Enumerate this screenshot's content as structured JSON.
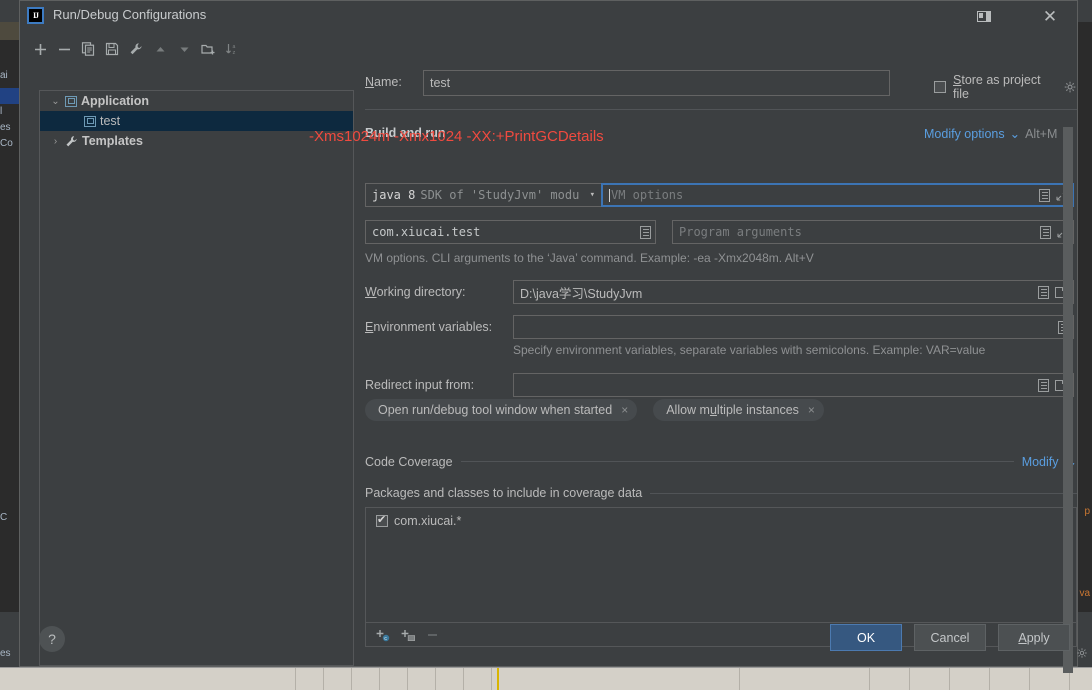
{
  "window": {
    "title": "Run/Debug Configurations",
    "logo_text": "IJ",
    "panel_toggle_icon": "split-panel-icon",
    "close_icon": "close-icon"
  },
  "toolbar": {
    "items": [
      {
        "name": "add-configuration-button",
        "glyph": "+"
      },
      {
        "name": "remove-configuration-button",
        "glyph": "−"
      },
      {
        "name": "copy-configuration-button",
        "glyph": "copy-icon"
      },
      {
        "name": "save-configuration-button",
        "glyph": "save-icon"
      },
      {
        "name": "edit-templates-button",
        "glyph": "wrench-icon"
      },
      {
        "name": "move-up-button",
        "glyph": "▲"
      },
      {
        "name": "move-down-button",
        "glyph": "▼"
      },
      {
        "name": "new-folder-button",
        "glyph": "folder-plus-icon"
      },
      {
        "name": "sort-alphabetically-button",
        "glyph": "sort-az-icon"
      }
    ]
  },
  "tree": {
    "nodes": [
      {
        "label": "Application",
        "expanded": true,
        "selected": false,
        "chevron": "⌄",
        "icon": "application-icon"
      },
      {
        "label": "test",
        "expanded": false,
        "selected": true,
        "chevron": "",
        "icon": "application-icon"
      },
      {
        "label": "Templates",
        "expanded": false,
        "selected": false,
        "chevron": "›",
        "icon": "wrench-icon"
      }
    ]
  },
  "settings": {
    "name_label": "Name:",
    "name_value": "test",
    "store_as_project_file": {
      "label": "Store as project file",
      "checked": false,
      "gear_icon": "gear-icon"
    },
    "build_and_run": {
      "section_title": "Build and run",
      "modify_options_link": "Modify options",
      "modify_options_caret": "⌄",
      "modify_options_accel": "Alt+M",
      "jdk_value_bold": "java 8",
      "jdk_value_rest": "SDK of 'StudyJvm' modu",
      "jdk_caret": "▾",
      "vm_options_placeholder": "VM options",
      "vm_options_value": "",
      "main_class_value": "com.xiucai.test",
      "program_arguments_placeholder": "Program arguments",
      "hint": "VM options. CLI arguments to the ‘Java’ command. Example: -ea -Xmx2048m. Alt+V"
    },
    "working_directory": {
      "label": "Working directory:",
      "value": "D:\\java学习\\StudyJvm"
    },
    "environment_variables": {
      "label": "Environment variables:",
      "value": "",
      "hint": "Specify environment variables, separate variables with semicolons. Example: VAR=value"
    },
    "redirect_input": {
      "label": "Redirect input from:",
      "value": ""
    },
    "chips": [
      {
        "label": "Open run/debug tool window when started",
        "close": "×"
      },
      {
        "label": "Allow multiple instances",
        "close": "×"
      }
    ],
    "code_coverage": {
      "section_title": "Code Coverage",
      "modify_link": "Modify",
      "modify_caret": "⌄",
      "packages_title": "Packages and classes to include in coverage data",
      "items": [
        {
          "label": "com.xiucai.*",
          "checked": true
        }
      ],
      "list_toolbar": [
        {
          "name": "add-class-button",
          "glyph": "+"
        },
        {
          "name": "add-package-button",
          "glyph": "+"
        },
        {
          "name": "remove-entry-button",
          "glyph": "−"
        }
      ]
    }
  },
  "annotation": {
    "text": "-Xms1024m -Xmx1024 -XX:+PrintGCDetails",
    "color": "#f04a3f"
  },
  "footer": {
    "help_label": "?",
    "ok_label": "OK",
    "cancel_label": "Cancel",
    "apply_label": "Apply"
  },
  "background_ide": {
    "left_fragments": [
      "ai",
      "l",
      "es",
      "Co",
      "C"
    ],
    "right_fragments": [
      "p",
      "va"
    ]
  },
  "colors": {
    "accent": "#365880",
    "link": "#5a9ee0",
    "annotation": "#f04a3f",
    "selection": "#0d293f",
    "dialog_bg": "#3c3f41"
  }
}
